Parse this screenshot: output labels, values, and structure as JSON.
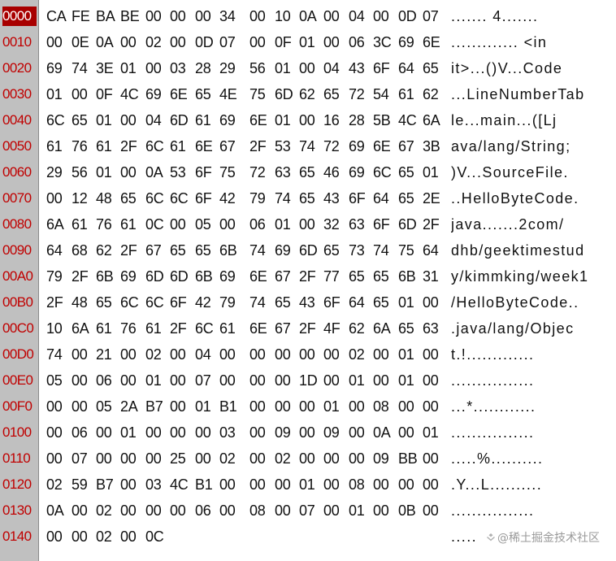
{
  "hex_editor": {
    "rows": [
      {
        "offset": "0000",
        "bytes": [
          "CA",
          "FE",
          "BA",
          "BE",
          "00",
          "00",
          "00",
          "34",
          "00",
          "10",
          "0A",
          "00",
          "04",
          "00",
          "0D",
          "07"
        ],
        "ascii": "....... 4......."
      },
      {
        "offset": "0010",
        "bytes": [
          "00",
          "0E",
          "0A",
          "00",
          "02",
          "00",
          "0D",
          "07",
          "00",
          "0F",
          "01",
          "00",
          "06",
          "3C",
          "69",
          "6E"
        ],
        "ascii": "............. <in"
      },
      {
        "offset": "0020",
        "bytes": [
          "69",
          "74",
          "3E",
          "01",
          "00",
          "03",
          "28",
          "29",
          "56",
          "01",
          "00",
          "04",
          "43",
          "6F",
          "64",
          "65"
        ],
        "ascii": "it>...()V...Code"
      },
      {
        "offset": "0030",
        "bytes": [
          "01",
          "00",
          "0F",
          "4C",
          "69",
          "6E",
          "65",
          "4E",
          "75",
          "6D",
          "62",
          "65",
          "72",
          "54",
          "61",
          "62"
        ],
        "ascii": "...LineNumberTab"
      },
      {
        "offset": "0040",
        "bytes": [
          "6C",
          "65",
          "01",
          "00",
          "04",
          "6D",
          "61",
          "69",
          "6E",
          "01",
          "00",
          "16",
          "28",
          "5B",
          "4C",
          "6A"
        ],
        "ascii": "le...main...([Lj"
      },
      {
        "offset": "0050",
        "bytes": [
          "61",
          "76",
          "61",
          "2F",
          "6C",
          "61",
          "6E",
          "67",
          "2F",
          "53",
          "74",
          "72",
          "69",
          "6E",
          "67",
          "3B"
        ],
        "ascii": "ava/lang/String;"
      },
      {
        "offset": "0060",
        "bytes": [
          "29",
          "56",
          "01",
          "00",
          "0A",
          "53",
          "6F",
          "75",
          "72",
          "63",
          "65",
          "46",
          "69",
          "6C",
          "65",
          "01"
        ],
        "ascii": ")V...SourceFile."
      },
      {
        "offset": "0070",
        "bytes": [
          "00",
          "12",
          "48",
          "65",
          "6C",
          "6C",
          "6F",
          "42",
          "79",
          "74",
          "65",
          "43",
          "6F",
          "64",
          "65",
          "2E"
        ],
        "ascii": "..HelloByteCode."
      },
      {
        "offset": "0080",
        "bytes": [
          "6A",
          "61",
          "76",
          "61",
          "0C",
          "00",
          "05",
          "00",
          "06",
          "01",
          "00",
          "32",
          "63",
          "6F",
          "6D",
          "2F"
        ],
        "ascii": "java.......2com/"
      },
      {
        "offset": "0090",
        "bytes": [
          "64",
          "68",
          "62",
          "2F",
          "67",
          "65",
          "65",
          "6B",
          "74",
          "69",
          "6D",
          "65",
          "73",
          "74",
          "75",
          "64"
        ],
        "ascii": "dhb/geektimestud"
      },
      {
        "offset": "00A0",
        "bytes": [
          "79",
          "2F",
          "6B",
          "69",
          "6D",
          "6D",
          "6B",
          "69",
          "6E",
          "67",
          "2F",
          "77",
          "65",
          "65",
          "6B",
          "31"
        ],
        "ascii": "y/kimmking/week1"
      },
      {
        "offset": "00B0",
        "bytes": [
          "2F",
          "48",
          "65",
          "6C",
          "6C",
          "6F",
          "42",
          "79",
          "74",
          "65",
          "43",
          "6F",
          "64",
          "65",
          "01",
          "00"
        ],
        "ascii": "/HelloByteCode.."
      },
      {
        "offset": "00C0",
        "bytes": [
          "10",
          "6A",
          "61",
          "76",
          "61",
          "2F",
          "6C",
          "61",
          "6E",
          "67",
          "2F",
          "4F",
          "62",
          "6A",
          "65",
          "63"
        ],
        "ascii": ".java/lang/Objec"
      },
      {
        "offset": "00D0",
        "bytes": [
          "74",
          "00",
          "21",
          "00",
          "02",
          "00",
          "04",
          "00",
          "00",
          "00",
          "00",
          "00",
          "02",
          "00",
          "01",
          "00"
        ],
        "ascii": "t.!............."
      },
      {
        "offset": "00E0",
        "bytes": [
          "05",
          "00",
          "06",
          "00",
          "01",
          "00",
          "07",
          "00",
          "00",
          "00",
          "1D",
          "00",
          "01",
          "00",
          "01",
          "00"
        ],
        "ascii": "................"
      },
      {
        "offset": "00F0",
        "bytes": [
          "00",
          "00",
          "05",
          "2A",
          "B7",
          "00",
          "01",
          "B1",
          "00",
          "00",
          "00",
          "01",
          "00",
          "08",
          "00",
          "00"
        ],
        "ascii": "...*............"
      },
      {
        "offset": "0100",
        "bytes": [
          "00",
          "06",
          "00",
          "01",
          "00",
          "00",
          "00",
          "03",
          "00",
          "09",
          "00",
          "09",
          "00",
          "0A",
          "00",
          "01"
        ],
        "ascii": "................"
      },
      {
        "offset": "0110",
        "bytes": [
          "00",
          "07",
          "00",
          "00",
          "00",
          "25",
          "00",
          "02",
          "00",
          "02",
          "00",
          "00",
          "00",
          "09",
          "BB",
          "00"
        ],
        "ascii": ".....%.........."
      },
      {
        "offset": "0120",
        "bytes": [
          "02",
          "59",
          "B7",
          "00",
          "03",
          "4C",
          "B1",
          "00",
          "00",
          "00",
          "01",
          "00",
          "08",
          "00",
          "00",
          "00"
        ],
        "ascii": ".Y...L.........."
      },
      {
        "offset": "0130",
        "bytes": [
          "0A",
          "00",
          "02",
          "00",
          "00",
          "00",
          "06",
          "00",
          "08",
          "00",
          "07",
          "00",
          "01",
          "00",
          "0B",
          "00"
        ],
        "ascii": "................"
      },
      {
        "offset": "0140",
        "bytes": [
          "00",
          "00",
          "02",
          "00",
          "0C"
        ],
        "ascii": "....."
      }
    ],
    "selected_offset": "0000"
  },
  "watermark": {
    "text": "@稀土掘金技术社区",
    "icon": "juejin-logo-icon",
    "color": "#9a9a9a"
  },
  "colors": {
    "offset_text": "#c00000",
    "offset_selected_bg": "#a80000",
    "gutter_bg": "#c0c0c0",
    "byte_text": "#111111"
  }
}
